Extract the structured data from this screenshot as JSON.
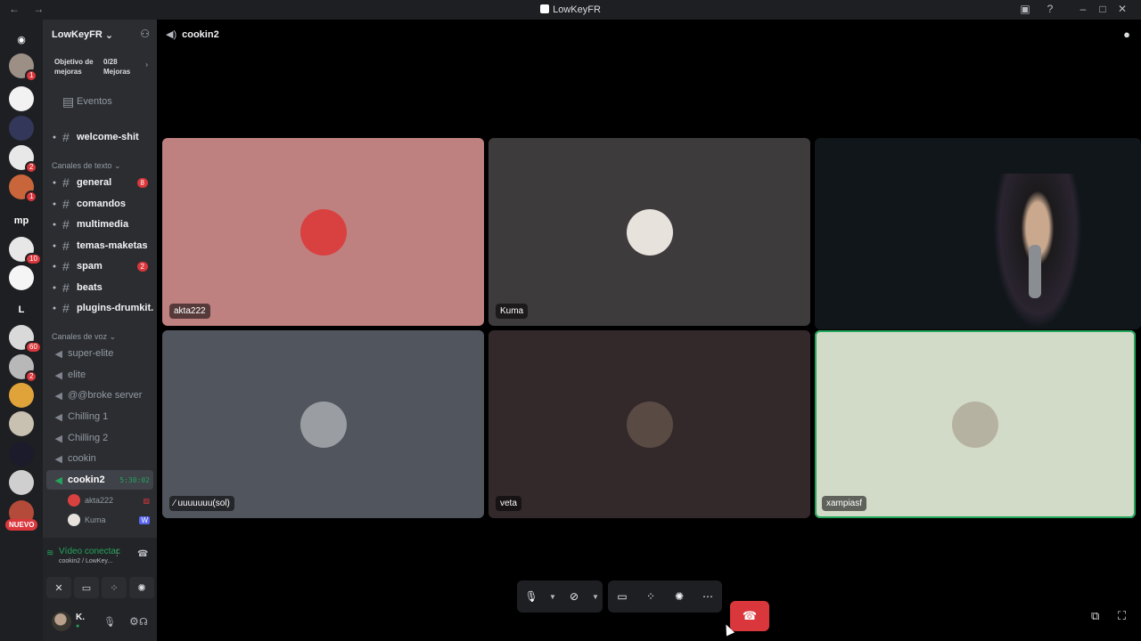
{
  "window": {
    "title": "LowKeyFR",
    "nav_glyphs": "← →",
    "controls": [
      "–",
      "□",
      "✕"
    ],
    "toolbar_icons": [
      "inbox-icon",
      "help-icon"
    ]
  },
  "guilds": [
    {
      "name": "home",
      "glyph": "◉",
      "bg": "#1e1f22",
      "badge": ""
    },
    {
      "name": "guild-1",
      "glyph": "",
      "bg": "#9b8f86",
      "badge": "1"
    },
    {
      "name": "guild-2",
      "glyph": "",
      "bg": "#f2f2f2",
      "badge": ""
    },
    {
      "name": "guild-3",
      "glyph": "",
      "bg": "#33385a",
      "badge": ""
    },
    {
      "name": "guild-4",
      "glyph": "",
      "bg": "#e8e8e8",
      "badge": "2"
    },
    {
      "name": "guild-5",
      "glyph": "",
      "bg": "#c9653a",
      "badge": "1"
    },
    {
      "name": "guild-mp",
      "glyph": "mp",
      "bg": "#1e1f22",
      "badge": ""
    },
    {
      "name": "guild-7",
      "glyph": "",
      "bg": "#e7e7e7",
      "badge": "10"
    },
    {
      "name": "guild-8",
      "glyph": "",
      "bg": "#f5f5f5",
      "badge": ""
    },
    {
      "name": "guild-L",
      "glyph": "L",
      "bg": "#1e1f22",
      "badge": ""
    },
    {
      "name": "guild-10",
      "glyph": "",
      "bg": "#d9d9d9",
      "badge": "60"
    },
    {
      "name": "guild-11",
      "glyph": "",
      "bg": "#b8b8b8",
      "badge": "2"
    },
    {
      "name": "guild-12",
      "glyph": "",
      "bg": "#e0a33a",
      "badge": ""
    },
    {
      "name": "guild-13",
      "glyph": "",
      "bg": "#c8c0b0",
      "badge": ""
    },
    {
      "name": "guild-14",
      "glyph": "",
      "bg": "#1b1b2b",
      "badge": ""
    },
    {
      "name": "guild-15",
      "glyph": "",
      "bg": "#cfcfcf",
      "badge": ""
    },
    {
      "name": "guild-16",
      "glyph": "",
      "bg": "#b44a3a",
      "badge": ""
    }
  ],
  "nuevo_label": "NUEVO",
  "server": {
    "name": "LowKeyFR",
    "boost": {
      "goal_label": "Objetivo de mejoras",
      "count_label": "0/28 Mejoras"
    },
    "events_label": "Eventos",
    "top_channel": "welcome-shit",
    "text_category": "Canales de texto",
    "text_channels": [
      {
        "name": "general",
        "count": "8"
      },
      {
        "name": "comandos",
        "count": ""
      },
      {
        "name": "multimedia",
        "count": ""
      },
      {
        "name": "temas-maketas",
        "count": ""
      },
      {
        "name": "spam",
        "count": "2"
      },
      {
        "name": "beats",
        "count": ""
      },
      {
        "name": "plugins-drumkit...",
        "count": ""
      }
    ],
    "voice_category": "Canales de voz",
    "voice_channels": [
      "super-elite",
      "elite",
      "@@broke server",
      "Chilling 1",
      "Chilling 2",
      "cookin"
    ],
    "active_voice": {
      "name": "cookin2",
      "timer": "5:30:02"
    },
    "voice_members": [
      {
        "name": "akta222",
        "icon": "▨"
      },
      {
        "name": "Kuma",
        "icon": "W"
      }
    ]
  },
  "voice_panel": {
    "status": "Vídeo conectac",
    "subtitle": "cookin2 / LowKey..."
  },
  "user": {
    "name": "K.",
    "status": "●"
  },
  "stage": {
    "channel": "cookin2",
    "tiles": [
      {
        "name": "akta222",
        "bg": "#bf8080",
        "avatar_bg": "#d94040",
        "speaking": false
      },
      {
        "name": "Kuma",
        "bg": "#3e3b3d",
        "avatar_bg": "#e8e2dc",
        "speaking": false
      },
      {
        "name": "",
        "bg": "#10161a",
        "avatar_bg": "",
        "speaking": false
      },
      {
        "name": "uuuuuuu(sol)",
        "bg": "#50555e",
        "avatar_bg": "#9a9da2",
        "speaking": false
      },
      {
        "name": "veta",
        "bg": "#33292a",
        "avatar_bg": "#5a4a44",
        "speaking": false
      },
      {
        "name": "xampiasf",
        "bg": "#d2dac8",
        "avatar_bg": "#b6b2a2",
        "speaking": true
      }
    ]
  },
  "colors": {
    "accent_green": "#23a55a",
    "danger": "#da373c",
    "bg": "#000000"
  }
}
